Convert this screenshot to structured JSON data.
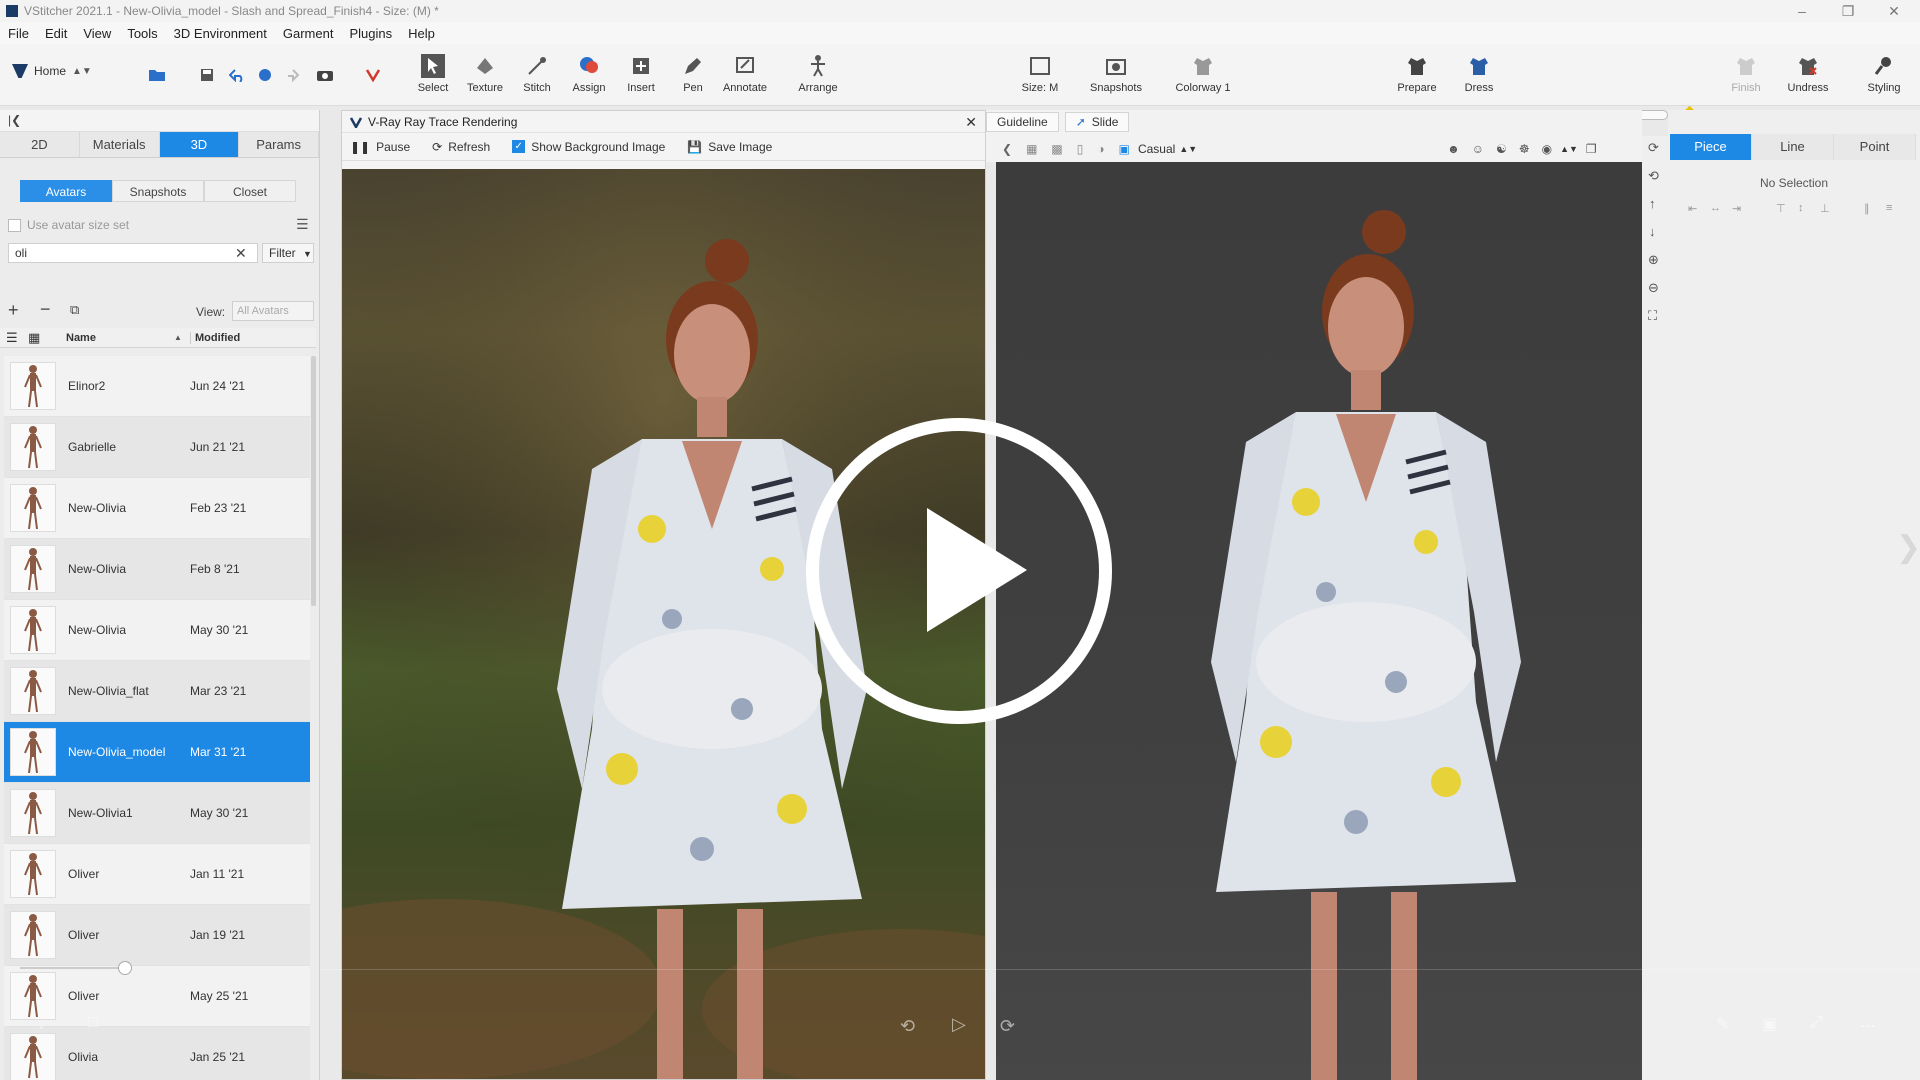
{
  "window": {
    "title": "VStitcher 2021.1 - New-Olivia_model - Slash and Spread_Finish4 - Size: (M) *"
  },
  "menu": [
    "File",
    "Edit",
    "View",
    "Tools",
    "3D Environment",
    "Garment",
    "Plugins",
    "Help"
  ],
  "toolbar": {
    "home_label": "Home",
    "tools": [
      "Select",
      "Texture",
      "Stitch",
      "Assign",
      "Insert",
      "Pen",
      "Annotate",
      "Arrange"
    ],
    "size_label": "Size: M",
    "snapshots_label": "Snapshots",
    "colorway_label": "Colorway 1",
    "prepare_label": "Prepare",
    "dress_label": "Dress",
    "finish_label": "Finish",
    "undress_label": "Undress",
    "styling_label": "Styling"
  },
  "left_panel": {
    "tabs": [
      "2D",
      "Materials",
      "3D",
      "Params"
    ],
    "subtabs": [
      "Avatars",
      "Snapshots",
      "Closet"
    ],
    "use_avatar_size_set": "Use avatar size set",
    "search_value": "oli",
    "filter_label": "Filter",
    "view_label": "View:",
    "view_value": "All Avatars",
    "col_name": "Name",
    "col_modified": "Modified",
    "avatars": [
      {
        "name": "Elinor2",
        "modified": "Jun 24 '21"
      },
      {
        "name": "Gabrielle",
        "modified": "Jun 21 '21"
      },
      {
        "name": "New-Olivia",
        "modified": "Feb 23 '21"
      },
      {
        "name": "New-Olivia",
        "modified": "Feb 8 '21"
      },
      {
        "name": "New-Olivia",
        "modified": "May 30 '21"
      },
      {
        "name": "New-Olivia_flat",
        "modified": "Mar 23 '21"
      },
      {
        "name": "New-Olivia_model",
        "modified": "Mar 31 '21"
      },
      {
        "name": "New-Olivia1",
        "modified": "May 30 '21"
      },
      {
        "name": "Oliver",
        "modified": "Jan 11 '21"
      },
      {
        "name": "Oliver",
        "modified": "Jan 19 '21"
      },
      {
        "name": "Oliver",
        "modified": "May 25 '21"
      },
      {
        "name": "Olivia",
        "modified": "Jan 25 '21"
      }
    ],
    "selected_index": 6
  },
  "render_window": {
    "title": "V-Ray Ray Trace Rendering",
    "pause_label": "Pause",
    "refresh_label": "Refresh",
    "show_bg_label": "Show Background Image",
    "save_label": "Save Image"
  },
  "viewport": {
    "guideline_label": "Guideline",
    "slide_label": "Slide",
    "environment_label": "Casual"
  },
  "right_panel": {
    "tabs": [
      "Piece",
      "Line",
      "Point"
    ],
    "no_selection": "No Selection"
  },
  "colors": {
    "accent": "#1e88e5",
    "viewport_bg": "#3f3f3f"
  }
}
